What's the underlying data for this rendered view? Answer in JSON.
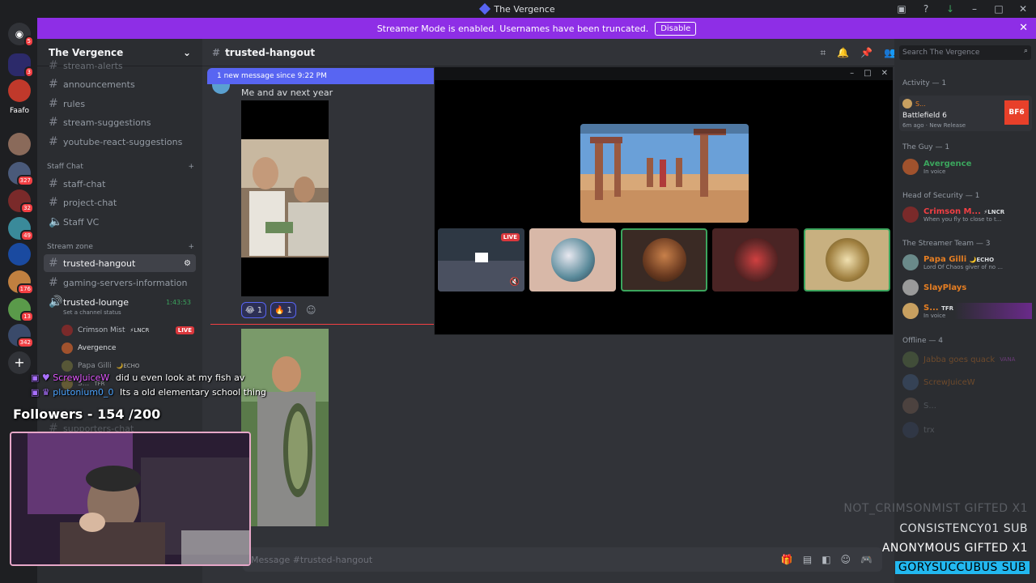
{
  "window": {
    "title": "The Vergence"
  },
  "banner": {
    "text": "Streamer Mode is enabled. Usernames have been truncated.",
    "button": "Disable"
  },
  "guild_badges": [
    "5",
    "3",
    "327",
    "32",
    "49",
    "176",
    "13",
    "342"
  ],
  "guild_label": "Faafo",
  "server": {
    "name": "The Vergence"
  },
  "channels": {
    "top": [
      {
        "name": "stream-alerts"
      },
      {
        "name": "announcements"
      },
      {
        "name": "rules"
      },
      {
        "name": "stream-suggestions"
      },
      {
        "name": "youtube-react-suggestions"
      }
    ],
    "staff_category": "Staff Chat",
    "staff": [
      {
        "name": "staff-chat"
      },
      {
        "name": "project-chat"
      },
      {
        "name": "Staff VC"
      }
    ],
    "stream_category": "Stream zone",
    "stream": [
      {
        "name": "trusted-hangout"
      },
      {
        "name": "gaming-servers-information"
      }
    ],
    "voice": {
      "name": "trusted-lounge",
      "timer": "1:43:53",
      "status": "Set a channel status",
      "users": [
        {
          "name": "Crimson Mist",
          "tag": "⚡LNCR",
          "live": "LIVE"
        },
        {
          "name": "Avergence",
          "tag": "",
          "live": ""
        },
        {
          "name": "Papa Gilli",
          "tag": "🌙ECHO",
          "live": ""
        },
        {
          "name": "S...",
          "tag": "TFR",
          "live": ""
        }
      ]
    },
    "bottom": "supporters-chat"
  },
  "chat": {
    "channel": "trusted-hangout",
    "new_message_bar": "1 new message since 9:22 PM",
    "message": "Me and av next year",
    "reactions": [
      {
        "emoji": "😂",
        "count": "1"
      },
      {
        "emoji": "🔥",
        "count": "1"
      }
    ],
    "composer_placeholder": "Message #trusted-hangout"
  },
  "members": {
    "search_placeholder": "Search The Vergence",
    "activity": {
      "header": "Activity — 1",
      "user": "S...",
      "game": "Battlefield 6",
      "time": "6m ago",
      "status": "New Release",
      "badge": "BF6"
    },
    "groups": [
      {
        "header": "The Guy — 1",
        "members": [
          {
            "name": "Avergence",
            "sub": "In voice",
            "color": "#3ba55d",
            "tag": ""
          }
        ]
      },
      {
        "header": "Head of Security — 1",
        "members": [
          {
            "name": "Crimson M...",
            "sub": "When you fly to close to t...",
            "color": "#f23f43",
            "tag": "⚡LNCR"
          }
        ]
      },
      {
        "header": "The Streamer Team — 3",
        "members": [
          {
            "name": "Papa Gilli",
            "sub": "Lord Of Chaos giver of no ...",
            "color": "#e67e22",
            "tag": "🌙ECHO"
          },
          {
            "name": "SlayPlays",
            "sub": "",
            "color": "#e67e22",
            "tag": ""
          },
          {
            "name": "S...",
            "sub": "In voice",
            "color": "#e67e22",
            "tag": "TFR"
          }
        ]
      }
    ],
    "offline_header": "Offline — 4",
    "offline": [
      "Jabba goes quack",
      "ScrewJuiceW",
      "S...",
      "trx"
    ],
    "offline_tag": "VANA"
  },
  "overlay": {
    "chat_lines": [
      {
        "user": "ScrewJuiceW",
        "text": "did u even look at my fish av",
        "color": "#e056fd"
      },
      {
        "user": "plutonium0_0",
        "text": "Its a old elementary school thing",
        "color": "#4aa3ff"
      }
    ],
    "followers": "Followers - 154 /200",
    "alerts": [
      {
        "text": "NOT_CRIMSONMIST  GIFTED X1"
      },
      {
        "text": "CONSISTENCY01  SUB"
      },
      {
        "text": "ANONYMOUS  GIFTED X1"
      },
      {
        "text": "GORYSUCCUBUS  SUB"
      }
    ],
    "live_label": "LIVE"
  }
}
